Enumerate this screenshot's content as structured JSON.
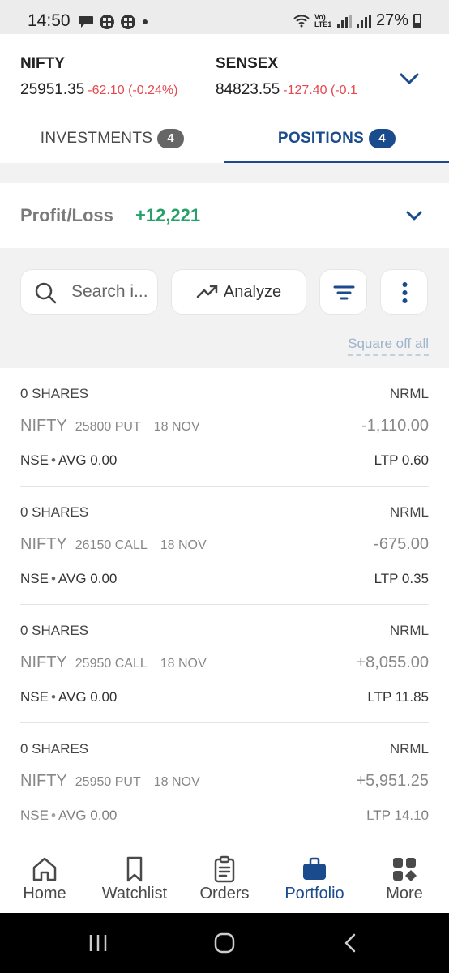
{
  "status_bar": {
    "time": "14:50",
    "battery": "27%",
    "network_label": "Vo) LTE1",
    "signal": "6"
  },
  "indices": [
    {
      "name": "NIFTY",
      "value": "25951.35",
      "change": "-62.10 (-0.24%)"
    },
    {
      "name": "SENSEX",
      "value": "84823.55",
      "change": "-127.40 (-0.1"
    }
  ],
  "tabs": [
    {
      "label": "INVESTMENTS",
      "count": "4",
      "active": false
    },
    {
      "label": "POSITIONS",
      "count": "4",
      "active": true
    }
  ],
  "summary": {
    "label": "Profit/Loss",
    "value": "+12,221"
  },
  "toolbar": {
    "search_placeholder": "Search i...",
    "analyze_label": "Analyze",
    "square_off_label": "Square off all"
  },
  "positions": [
    {
      "qty": "0 SHARES",
      "product": "NRML",
      "symbol": "NIFTY",
      "strike": "25800 PUT",
      "expiry": "18 NOV",
      "pnl": "-1,110.00",
      "exchange": "NSE",
      "avg_label": "AVG",
      "avg": "0.00",
      "ltp_label": "LTP",
      "ltp": "0.60"
    },
    {
      "qty": "0 SHARES",
      "product": "NRML",
      "symbol": "NIFTY",
      "strike": "26150 CALL",
      "expiry": "18 NOV",
      "pnl": "-675.00",
      "exchange": "NSE",
      "avg_label": "AVG",
      "avg": "0.00",
      "ltp_label": "LTP",
      "ltp": "0.35"
    },
    {
      "qty": "0 SHARES",
      "product": "NRML",
      "symbol": "NIFTY",
      "strike": "25950 CALL",
      "expiry": "18 NOV",
      "pnl": "+8,055.00",
      "exchange": "NSE",
      "avg_label": "AVG",
      "avg": "0.00",
      "ltp_label": "LTP",
      "ltp": "11.85"
    },
    {
      "qty": "0 SHARES",
      "product": "NRML",
      "symbol": "NIFTY",
      "strike": "25950 PUT",
      "expiry": "18 NOV",
      "pnl": "+5,951.25",
      "exchange": "NSE",
      "avg_label": "AVG",
      "avg": "0.00",
      "ltp_label": "LTP",
      "ltp": "14.10"
    }
  ],
  "bottom_nav": [
    {
      "label": "Home",
      "icon": "home-icon"
    },
    {
      "label": "Watchlist",
      "icon": "bookmark-icon"
    },
    {
      "label": "Orders",
      "icon": "clipboard-icon"
    },
    {
      "label": "Portfolio",
      "icon": "briefcase-icon",
      "active": true
    },
    {
      "label": "More",
      "icon": "grid-icon"
    }
  ],
  "colors": {
    "accent": "#1a4b8c",
    "profit": "#27a06a",
    "loss": "#e5484d"
  }
}
